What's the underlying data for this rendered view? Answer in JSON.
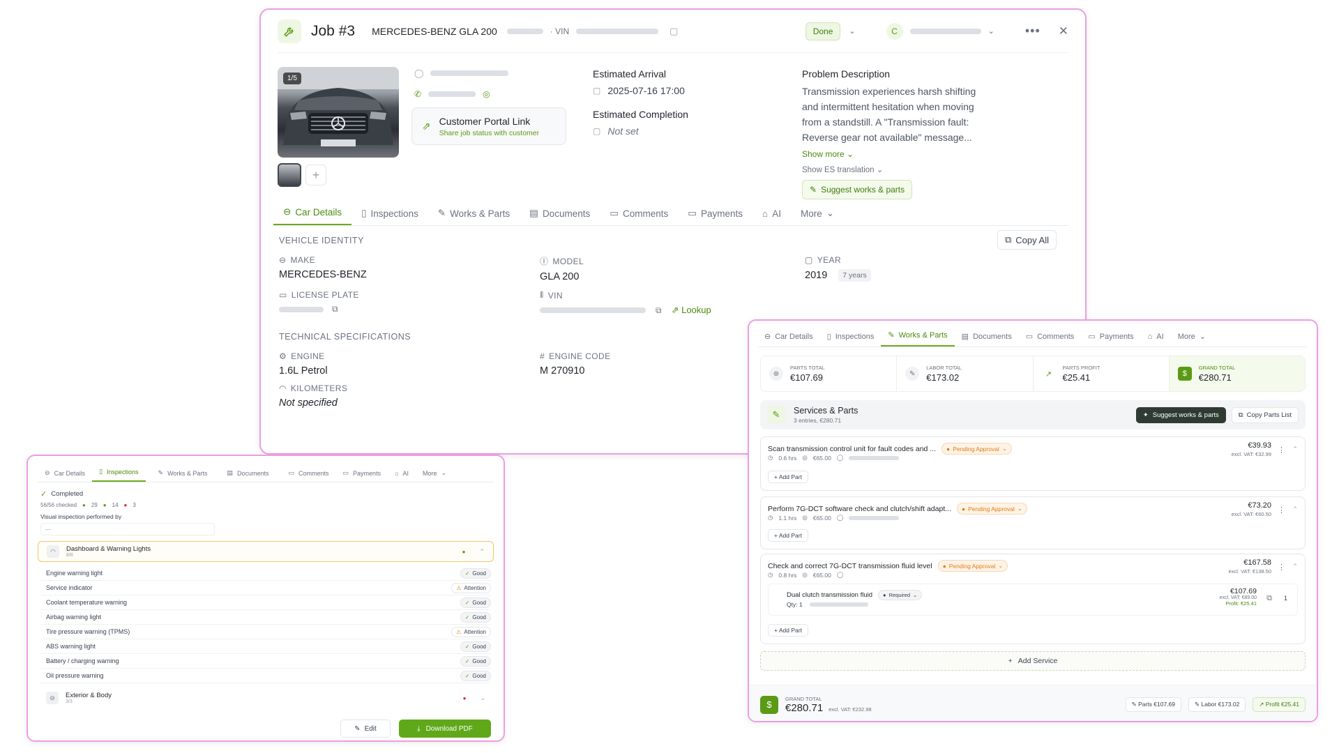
{
  "main": {
    "title": "Job #3",
    "vehicle": "MERCEDES-BENZ GLA 200",
    "vin_label": "· VIN",
    "status": "Done",
    "assignee_initial": "C",
    "photo_counter": "1/5",
    "portal": {
      "title": "Customer Portal Link",
      "subtitle": "Share job status with customer"
    },
    "est_arrival_label": "Estimated Arrival",
    "est_arrival_value": "2025-07-16 17:00",
    "est_completion_label": "Estimated Completion",
    "est_completion_value": "Not set",
    "problem_label": "Problem Description",
    "problem_lines": [
      "Transmission experiences harsh shifting",
      "and intermittent hesitation when moving",
      "from a standstill. A \"Transmission fault:",
      "Reverse gear not available\" message..."
    ],
    "show_more": "Show more",
    "show_translation": "Show ES translation",
    "suggest_btn": "Suggest works & parts",
    "tabs": [
      "Car Details",
      "Inspections",
      "Works & Parts",
      "Documents",
      "Comments",
      "Payments",
      "AI",
      "More"
    ],
    "vehicle_identity": "VEHICLE IDENTITY",
    "copy_all": "Copy All",
    "make_label": "MAKE",
    "make_value": "MERCEDES-BENZ",
    "model_label": "MODEL",
    "model_value": "GLA 200",
    "year_label": "YEAR",
    "year_value": "2019",
    "year_badge": "7 years",
    "plate_label": "LICENSE PLATE",
    "vin_field_label": "VIN",
    "lookup": "Lookup",
    "tech_specs": "TECHNICAL SPECIFICATIONS",
    "engine_label": "ENGINE",
    "engine_value": "1.6L Petrol",
    "engine_code_label": "ENGINE CODE",
    "engine_code_value": "M 270910",
    "km_label": "KILOMETERS",
    "km_value": "Not specified"
  },
  "works": {
    "tabs": [
      "Car Details",
      "Inspections",
      "Works & Parts",
      "Documents",
      "Comments",
      "Payments",
      "AI",
      "More"
    ],
    "totals": [
      {
        "label": "PARTS TOTAL",
        "value": "€107.69"
      },
      {
        "label": "LABOR TOTAL",
        "value": "€173.02"
      },
      {
        "label": "PARTS PROFIT",
        "value": "€25.41"
      },
      {
        "label": "GRAND TOTAL",
        "value": "€280.71"
      }
    ],
    "section_title": "Services & Parts",
    "section_sub": "3 entries, €280.71",
    "suggest_btn": "Suggest works & parts",
    "copy_parts": "Copy Parts List",
    "services": [
      {
        "name": "Scan transmission control unit for fault codes and ...",
        "status": "Pending Approval",
        "hrs": "0.6 hrs",
        "rate": "€65.00",
        "price": "€39.93",
        "excl": "excl. VAT: €32.99"
      },
      {
        "name": "Perform 7G-DCT software check and clutch/shift adapt...",
        "status": "Pending Approval",
        "hrs": "1.1 hrs",
        "rate": "€65.00",
        "price": "€73.20",
        "excl": "excl. VAT: €60.50"
      },
      {
        "name": "Check and correct 7G-DCT transmission fluid level",
        "status": "Pending Approval",
        "hrs": "0.8 hrs",
        "rate": "€65.00",
        "price": "€167.58",
        "excl": "excl. VAT: €138.50"
      }
    ],
    "part": {
      "name": "Dual clutch transmission fluid",
      "tag": "Required",
      "qty": "Qty: 1",
      "price": "€107.69",
      "excl": "excl. VAT: €89.00",
      "profit": "Profit: €25.41",
      "count": "1"
    },
    "add_part": "Add Part",
    "add_service": "Add Service",
    "footer_label": "GRAND TOTAL",
    "footer_total": "€280.71",
    "footer_excl": "excl. VAT: €232.98",
    "footer_parts": "Parts €107.69",
    "footer_labor": "Labor €173.02",
    "footer_profit": "Profit €25.41"
  },
  "inspect": {
    "tabs": [
      "Car Details",
      "Inspections",
      "Works & Parts",
      "Documents",
      "Comments",
      "Payments",
      "AI",
      "More"
    ],
    "completed": "Completed",
    "checked": "56/56 checked",
    "count_green": "29",
    "count_orange": "14",
    "count_red": "3",
    "performed_by": "Visual inspection performed by",
    "performer_placeholder": "—",
    "group1_title": "Dashboard & Warning Lights",
    "group1_sub": "8/8",
    "items": [
      {
        "name": "Engine warning light",
        "status": "Good"
      },
      {
        "name": "Service indicator",
        "status": "Attention"
      },
      {
        "name": "Coolant temperature warning",
        "status": "Good"
      },
      {
        "name": "Airbag warning light",
        "status": "Good"
      },
      {
        "name": "Tire pressure warning (TPMS)",
        "status": "Attention"
      },
      {
        "name": "ABS warning light",
        "status": "Good"
      },
      {
        "name": "Battery / charging warning",
        "status": "Good"
      },
      {
        "name": "Oil pressure warning",
        "status": "Good"
      }
    ],
    "group2_title": "Exterior & Body",
    "group2_sub": "3/3",
    "edit": "Edit",
    "download": "Download PDF"
  },
  "colors": {
    "accent": "#6aab1e",
    "pending": "#e07b13",
    "frame": "#ec9de4"
  }
}
